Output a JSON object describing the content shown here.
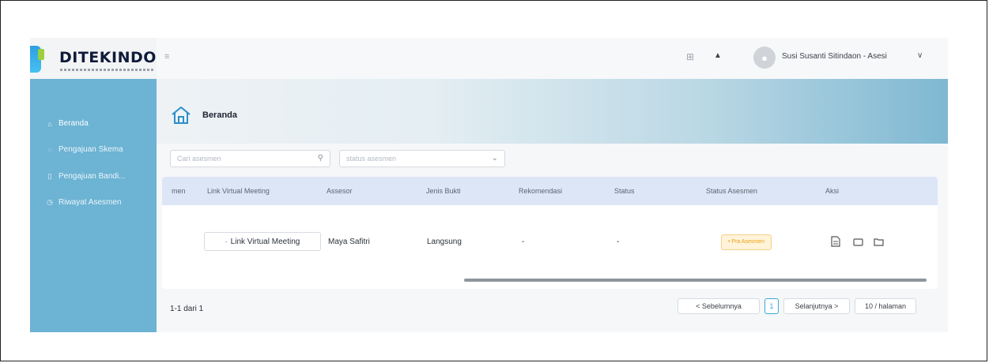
{
  "brand": {
    "name": "DITEKINDO"
  },
  "sidebar": {
    "items": [
      {
        "label": "Beranda",
        "icon": "home-icon"
      },
      {
        "label": "Pengajuan Skema",
        "icon": "clipboard-icon"
      },
      {
        "label": "Pengajuan Bandi...",
        "icon": "document-icon"
      },
      {
        "label": "Riwayat Asesmen",
        "icon": "history-icon"
      }
    ]
  },
  "topbar": {
    "menu_icon": "≡",
    "user": {
      "name": "Susi Susanti Sitindaon - Asesi"
    }
  },
  "banner": {
    "title": "Beranda"
  },
  "filters": {
    "search_placeholder": "Cari asesmen",
    "status_placeholder": "status asesmen"
  },
  "table": {
    "columns": [
      "men",
      "Link Virtual Meeting",
      "Assesor",
      "Jenis Bukti",
      "Rekomendasi",
      "Status",
      "Status Asesmen",
      "Aksi"
    ],
    "rows": [
      {
        "link_label": "Link Virtual Meeting",
        "assesor": "Maya Safitri",
        "jenis_bukti": "Langsung",
        "rekomendasi": "-",
        "status": "-",
        "status_asesmen": "• Pra Asesmen"
      }
    ]
  },
  "footer": {
    "count": "1-1 dari 1",
    "prev": "< Sebelumnya",
    "page": "1",
    "next": "Selanjutnya >",
    "page_size": "10 / halaman"
  },
  "colors": {
    "sidebar": "#6db3d3",
    "table_header": "#dde6f6",
    "badge_bg": "#fff3d9",
    "badge_text": "#e8a21a",
    "accent": "#3aa8d8"
  }
}
